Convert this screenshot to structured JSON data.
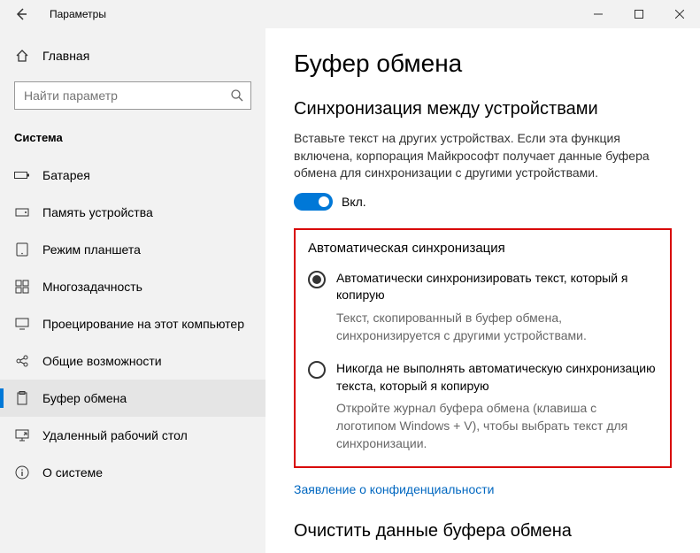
{
  "window": {
    "title": "Параметры"
  },
  "sidebar": {
    "home": "Главная",
    "search_placeholder": "Найти параметр",
    "category": "Система",
    "items": [
      {
        "label": "Батарея"
      },
      {
        "label": "Память устройства"
      },
      {
        "label": "Режим планшета"
      },
      {
        "label": "Многозадачность"
      },
      {
        "label": "Проецирование на этот компьютер"
      },
      {
        "label": "Общие возможности"
      },
      {
        "label": "Буфер обмена"
      },
      {
        "label": "Удаленный рабочий стол"
      },
      {
        "label": "О системе"
      }
    ]
  },
  "main": {
    "title": "Буфер обмена",
    "sync": {
      "heading": "Синхронизация между устройствами",
      "desc": "Вставьте текст на других устройствах. Если эта функция включена, корпорация Майкрософт получает данные буфера обмена для синхронизации с другими устройствами.",
      "toggle_state": "Вкл."
    },
    "auto": {
      "heading": "Автоматическая синхронизация",
      "opt1_label": "Автоматически синхронизировать текст, который я копирую",
      "opt1_desc": "Текст, скопированный в буфер обмена, синхронизируется с другими устройствами.",
      "opt2_label": "Никогда не выполнять автоматическую синхронизацию текста, который я копирую",
      "opt2_desc": "Откройте журнал буфера обмена (клавиша с логотипом Windows + V), чтобы выбрать текст для синхронизации."
    },
    "privacy_link": "Заявление о конфиденциальности",
    "clear_heading": "Очистить данные буфера обмена"
  }
}
